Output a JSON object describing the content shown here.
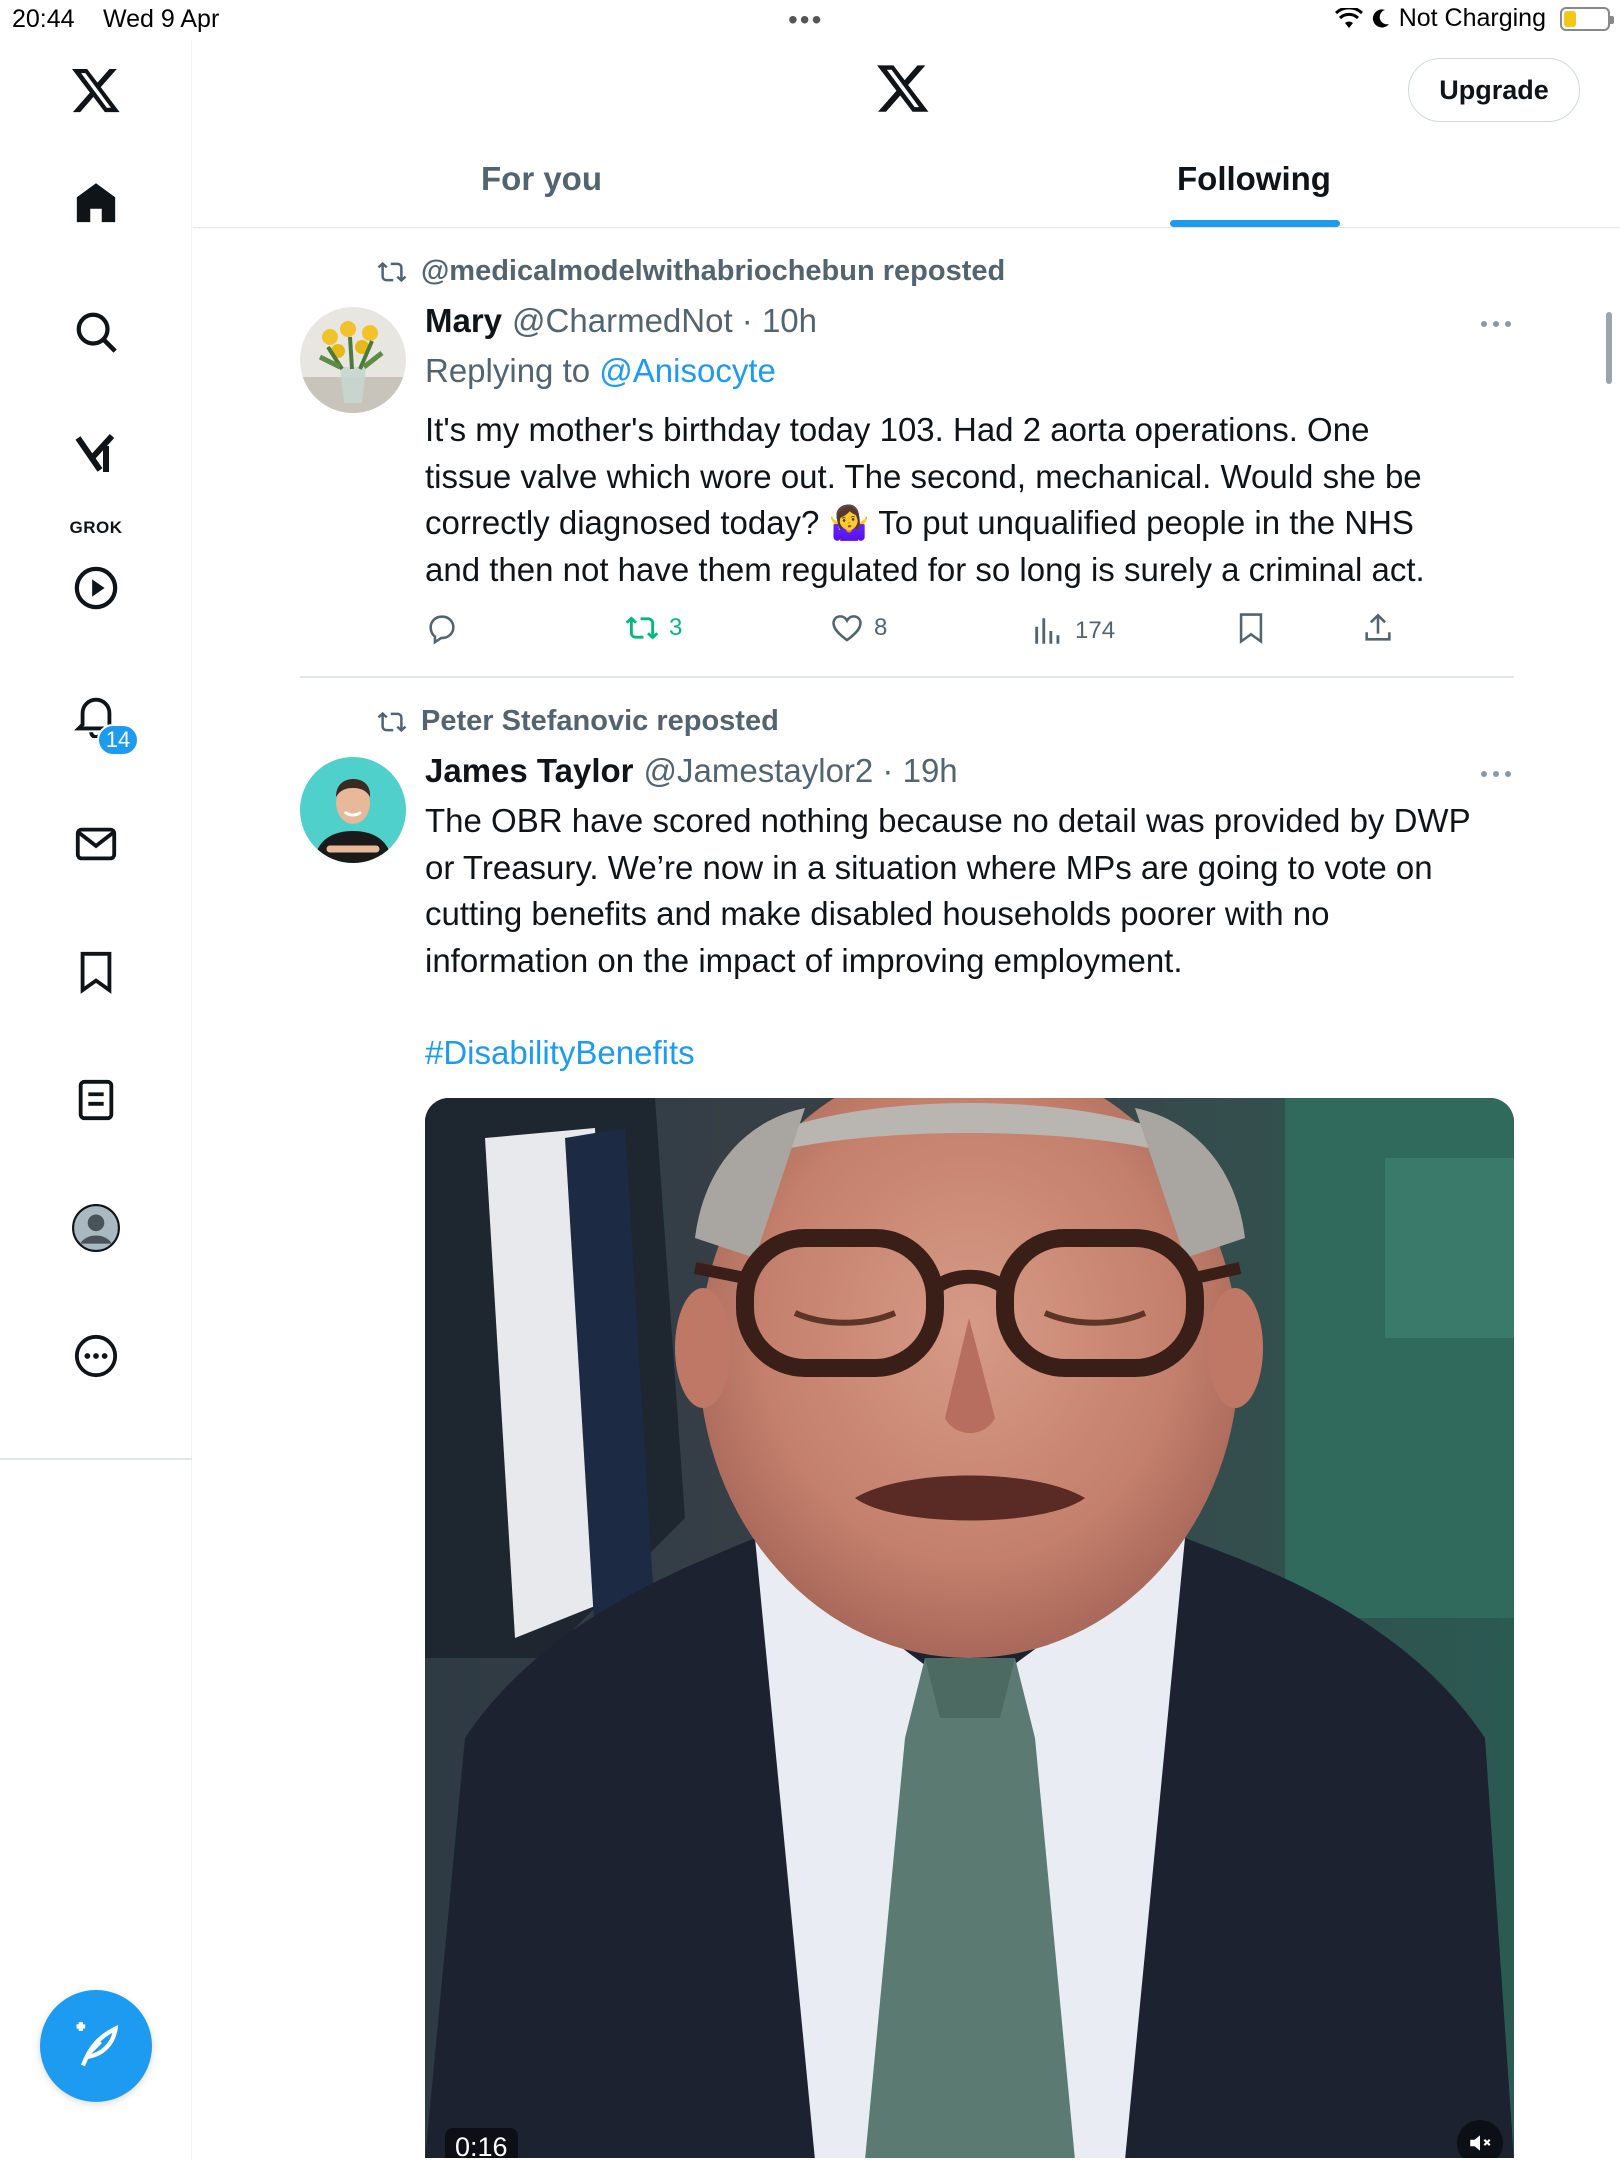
{
  "status_bar": {
    "time": "20:44",
    "date": "Wed 9 Apr",
    "battery_text": "Not Charging"
  },
  "sidebar": {
    "grok_label": "GROK",
    "notification_count": "14"
  },
  "header": {
    "upgrade_label": "Upgrade",
    "tabs": [
      {
        "label": "For you",
        "active": false
      },
      {
        "label": "Following",
        "active": true
      }
    ]
  },
  "tweets": [
    {
      "repost_line": "@medicalmodelwithabriochebun reposted",
      "name": "Mary",
      "handle": "@CharmedNot",
      "time": "10h",
      "replying_to_prefix": "Replying to",
      "replying_to_handle": "@Anisocyte",
      "text_lines": [
        "It's my mother's birthday today 103.  Had 2 aorta operations.  One",
        "tissue valve which wore out.  The second, mechanical. Would she be",
        "correctly diagnosed today?  🤷‍♀️ To put unqualified people in the NHS",
        "and then not have them regulated for so long is surely a criminal act."
      ],
      "reposts": "3",
      "likes": "8",
      "views": "174"
    },
    {
      "repost_line": "Peter Stefanovic reposted",
      "name": "James Taylor",
      "handle": "@Jamestaylor2",
      "time": "19h",
      "text_lines": [
        "The OBR have scored nothing because no detail was provided by DWP",
        "or Treasury. We’re now in a situation where MPs are going to vote on",
        "cutting benefits and make disabled households poorer with no",
        "information on the impact of improving employment."
      ],
      "hashtag": "#DisabilityBenefits",
      "video_duration": "0:16"
    }
  ],
  "colors": {
    "accent": "#1d9bf0",
    "repost_green": "#00ba7c",
    "secondary_text": "#536471"
  }
}
